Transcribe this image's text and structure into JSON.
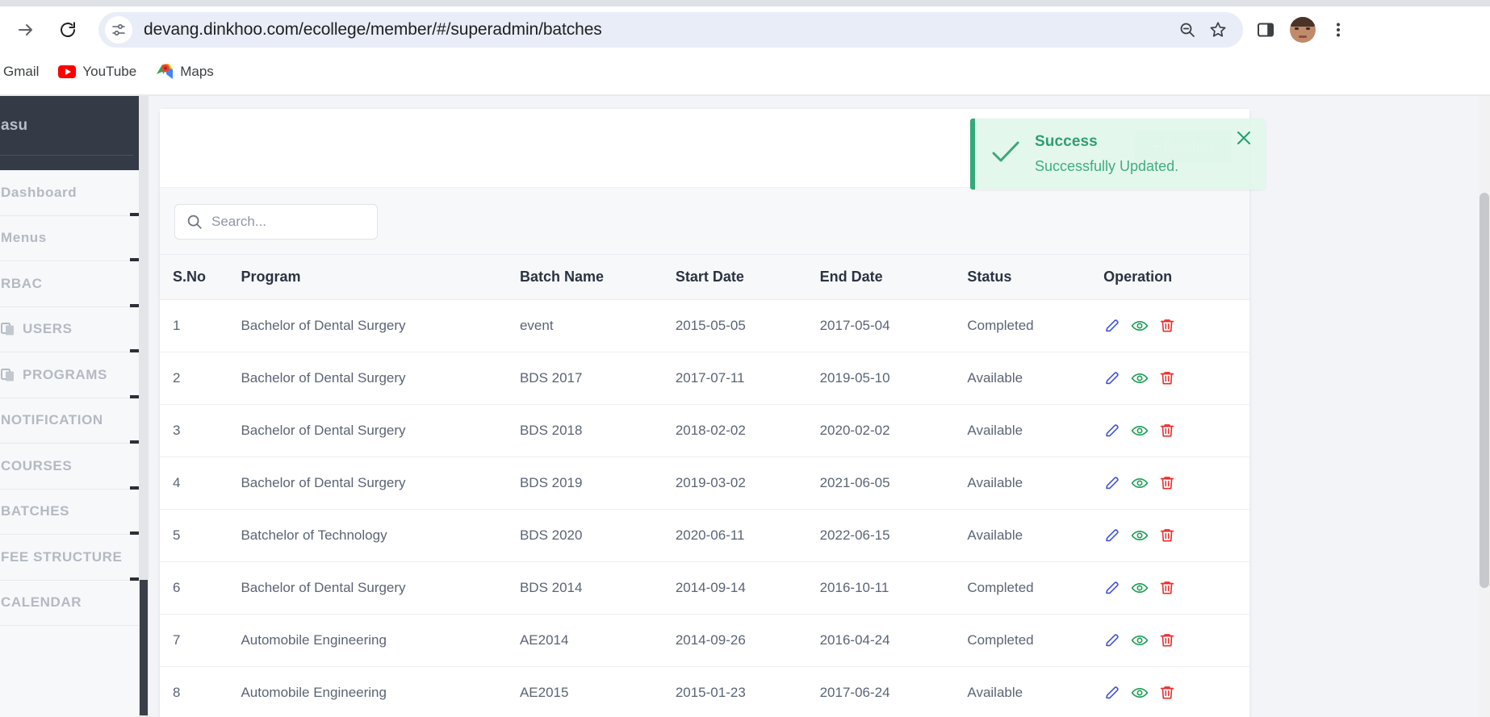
{
  "browser": {
    "url": "devang.dinkhoo.com/ecollege/member/#/superadmin/batches",
    "forward_label": "Forward",
    "reload_label": "Reload",
    "site_info_label": "View site information",
    "zoom_label": "Zoom",
    "bookmark_label": "Bookmark this tab",
    "side_panel_label": "Side panel",
    "profile_label": "Profile",
    "menu_label": "Customize and control Google Chrome",
    "bookmarks": [
      {
        "label": "Gmail",
        "icon": "gmail-icon"
      },
      {
        "label": "YouTube",
        "icon": "youtube-icon"
      },
      {
        "label": "Maps",
        "icon": "maps-icon"
      }
    ]
  },
  "sidebar": {
    "user": "asu",
    "items": [
      {
        "label": "Dashboard",
        "icon": null
      },
      {
        "label": "Menus",
        "icon": null
      },
      {
        "label": "RBAC",
        "icon": null
      },
      {
        "label": "USERS",
        "icon": "copy-icon"
      },
      {
        "label": "PROGRAMS",
        "icon": "copy-icon"
      },
      {
        "label": "NOTIFICATION",
        "icon": null
      },
      {
        "label": "COURSES",
        "icon": null
      },
      {
        "label": "BATCHES",
        "icon": null
      },
      {
        "label": "FEE STRUCTURE",
        "icon": null
      },
      {
        "label": "CALENDAR",
        "icon": null
      }
    ]
  },
  "toast": {
    "title": "Success",
    "message": "Successfully Updated.",
    "close_label": "Close",
    "accent_color": "#34a97b"
  },
  "card": {
    "add_button_label": "Batches",
    "add_button_plus": "+"
  },
  "search": {
    "value": "",
    "placeholder": "Search..."
  },
  "table": {
    "columns": [
      "S.No",
      "Program",
      "Batch Name",
      "Start Date",
      "End Date",
      "Status",
      "Operation"
    ],
    "operations": {
      "edit_label": "Edit",
      "view_label": "View",
      "delete_label": "Delete",
      "edit_color": "#3f51d6",
      "view_color": "#1f9e57",
      "delete_color": "#ee2b2b"
    },
    "rows": [
      {
        "sno": "1",
        "program": "Bachelor of Dental Surgery",
        "batch": "event",
        "start": "2015-05-05",
        "end": "2017-05-04",
        "status": "Completed"
      },
      {
        "sno": "2",
        "program": "Bachelor of Dental Surgery",
        "batch": "BDS 2017",
        "start": "2017-07-11",
        "end": "2019-05-10",
        "status": "Available"
      },
      {
        "sno": "3",
        "program": "Bachelor of Dental Surgery",
        "batch": "BDS 2018",
        "start": "2018-02-02",
        "end": "2020-02-02",
        "status": "Available"
      },
      {
        "sno": "4",
        "program": "Bachelor of Dental Surgery",
        "batch": "BDS 2019",
        "start": "2019-03-02",
        "end": "2021-06-05",
        "status": "Available"
      },
      {
        "sno": "5",
        "program": "Batchelor of Technology",
        "batch": "BDS 2020",
        "start": "2020-06-11",
        "end": "2022-06-15",
        "status": "Available"
      },
      {
        "sno": "6",
        "program": "Bachelor of Dental Surgery",
        "batch": "BDS 2014",
        "start": "2014-09-14",
        "end": "2016-10-11",
        "status": "Completed"
      },
      {
        "sno": "7",
        "program": "Automobile Engineering",
        "batch": "AE2014",
        "start": "2014-09-26",
        "end": "2016-04-24",
        "status": "Completed"
      },
      {
        "sno": "8",
        "program": "Automobile Engineering",
        "batch": "AE2015",
        "start": "2015-01-23",
        "end": "2017-06-24",
        "status": "Available"
      }
    ]
  }
}
